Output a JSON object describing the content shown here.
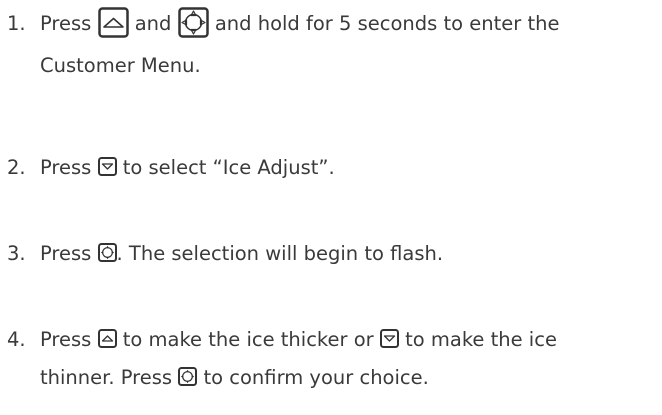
{
  "steps": [
    {
      "number": "1.",
      "a": "Press",
      "b": "and",
      "c": "and hold for 5 seconds to enter the",
      "d": "Customer Menu.",
      "icons": [
        "up-button-icon",
        "set-button-icon"
      ]
    },
    {
      "number": "2.",
      "a": "Press",
      "b": "to select “Ice Adjust”.",
      "icons": [
        "down-button-icon"
      ]
    },
    {
      "number": "3.",
      "a": "Press",
      "b": ". The selection will begin to flash.",
      "icons": [
        "set-button-icon"
      ]
    },
    {
      "number": "4.",
      "a": "Press",
      "b": "to make the ice thicker or",
      "c": "to make the ice",
      "d": "thinner. Press",
      "e": "to confirm your choice.",
      "icons": [
        "up-button-icon",
        "down-button-icon",
        "set-button-icon"
      ]
    }
  ]
}
